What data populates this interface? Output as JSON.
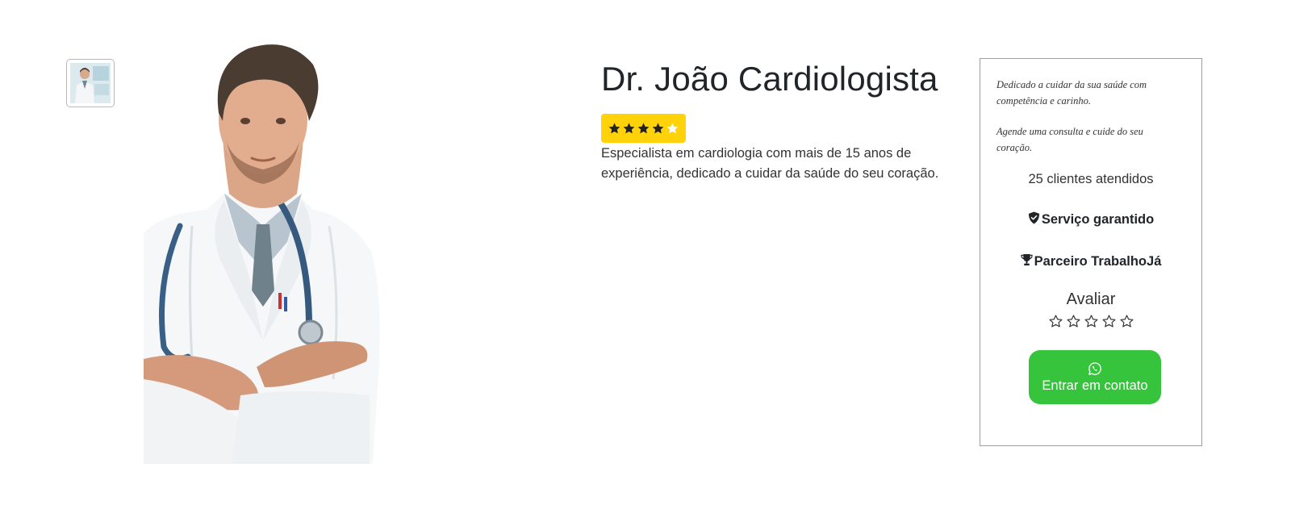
{
  "profile": {
    "name": "Dr. João Cardiologista",
    "rating": 4,
    "rating_max": 5,
    "description": "Especialista em cardiologia com mais de 15 anos de experiência, dedicado a cuidar da saúde do seu coração."
  },
  "sidebar": {
    "tagline_1": "Dedicado a cuidar da sua saúde com competência e carinho.",
    "tagline_2": "Agende uma consulta e cuide do seu coração.",
    "clients": "25 clientes atendidos",
    "feature_1": "Serviço garantido",
    "feature_2": "Parceiro TrabalhoJá",
    "rate_label": "Avaliar",
    "contact_label": "Entrar em contato"
  },
  "colors": {
    "badge": "#ffd20a",
    "contact_button": "#35c43b"
  },
  "icons": {
    "feature_1": "shield-check-icon",
    "feature_2": "trophy-icon",
    "contact": "whatsapp-icon"
  }
}
